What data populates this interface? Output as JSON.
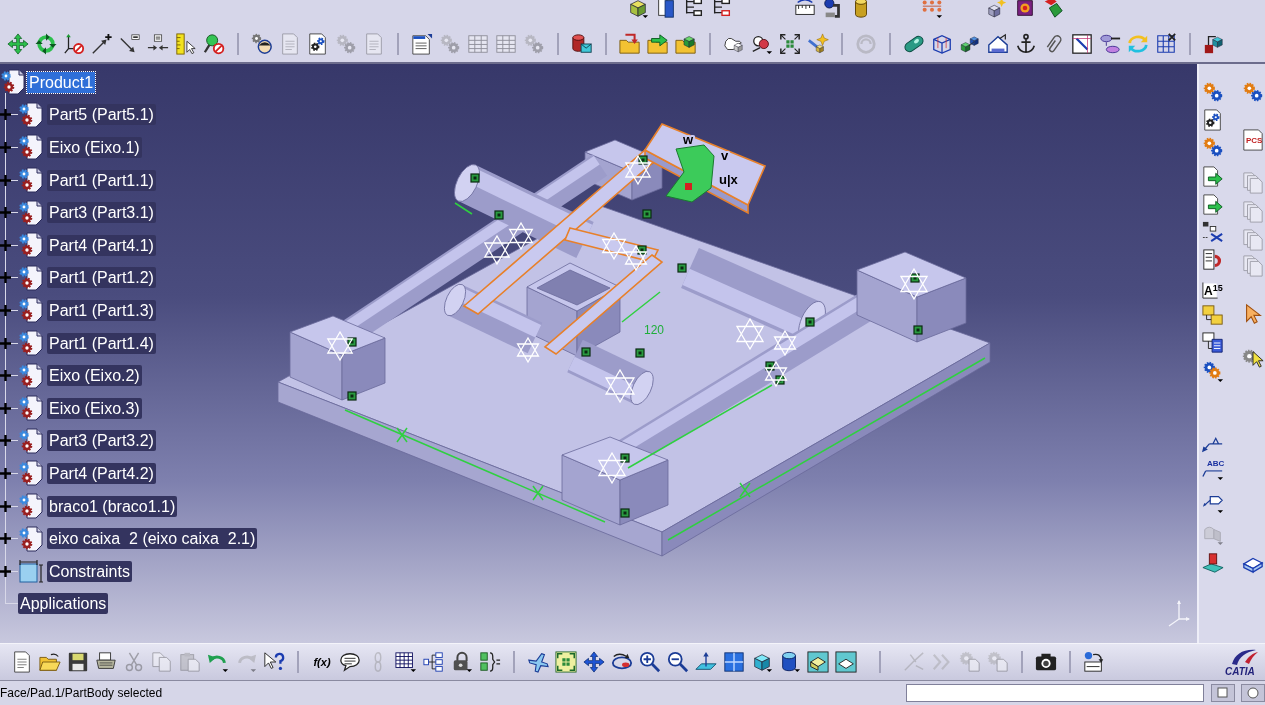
{
  "main_toolbar": {
    "buttons": [
      {
        "disabled": false
      },
      {
        "disabled": false
      },
      {
        "disabled": false
      },
      {
        "disabled": false
      },
      {
        "disabled": false
      },
      {
        "disabled": false
      },
      {
        "disabled": false
      },
      {
        "disabled": false
      },
      {
        "disabled": false
      },
      {
        "disabled": true
      },
      {
        "disabled": false
      },
      {
        "disabled": true
      },
      {
        "disabled": true
      },
      {
        "disabled": false
      },
      {
        "disabled": true
      },
      {
        "disabled": true
      },
      {
        "disabled": true
      },
      {
        "disabled": true
      },
      {
        "disabled": false
      },
      {
        "disabled": false
      },
      {
        "disabled": false
      },
      {
        "disabled": false
      },
      {
        "disabled": false
      },
      {
        "disabled": false
      },
      {
        "disabled": false
      },
      {
        "disabled": false
      },
      {
        "disabled": true
      },
      {
        "disabled": false
      },
      {
        "disabled": false
      },
      {
        "disabled": false
      },
      {
        "disabled": false
      },
      {
        "disabled": false
      },
      {
        "disabled": false
      },
      {
        "disabled": false
      },
      {
        "disabled": false
      },
      {
        "disabled": false
      },
      {
        "disabled": false
      },
      {
        "disabled": false
      }
    ]
  },
  "tree": {
    "root": {
      "label": "Product1",
      "selected": true
    },
    "children": [
      {
        "kind": "part",
        "label": "Part5 (Part5.1)",
        "expanded": false,
        "selected": false
      },
      {
        "kind": "part",
        "label": "Eixo (Eixo.1)",
        "expanded": false,
        "selected": false
      },
      {
        "kind": "part",
        "label": "Part1 (Part1.1)",
        "expanded": false,
        "selected": false
      },
      {
        "kind": "part",
        "label": "Part3 (Part3.1)",
        "expanded": false,
        "selected": false
      },
      {
        "kind": "part",
        "label": "Part4 (Part4.1)",
        "expanded": false,
        "selected": false
      },
      {
        "kind": "part",
        "label": "Part1 (Part1.2)",
        "expanded": false,
        "selected": false
      },
      {
        "kind": "part",
        "label": "Part1 (Part1.3)",
        "expanded": false,
        "selected": false
      },
      {
        "kind": "part",
        "label": "Part1 (Part1.4)",
        "expanded": false,
        "selected": false
      },
      {
        "kind": "part",
        "label": "Eixo (Eixo.2)",
        "expanded": false,
        "selected": false
      },
      {
        "kind": "part",
        "label": "Eixo (Eixo.3)",
        "expanded": false,
        "selected": false
      },
      {
        "kind": "part",
        "label": "Part3 (Part3.2)",
        "expanded": false,
        "selected": false
      },
      {
        "kind": "part",
        "label": "Part4 (Part4.2)",
        "expanded": false,
        "selected": false
      },
      {
        "kind": "part",
        "label": "braco1 (braco1.1)",
        "expanded": false,
        "selected": false
      },
      {
        "kind": "part",
        "label": "eixo caixa  2 (eixo caixa  2.1)",
        "expanded": false,
        "selected": false
      },
      {
        "kind": "constraints",
        "label": "Constraints",
        "expanded": false,
        "selected": false
      }
    ],
    "applications": {
      "label": "Applications",
      "selected": false
    }
  },
  "viewport": {
    "labels": [
      {
        "kind": "axis",
        "text": "w"
      },
      {
        "kind": "axis",
        "text": "v"
      },
      {
        "kind": "axis",
        "text": "u|x"
      },
      {
        "kind": "dimension",
        "text": "120"
      }
    ]
  },
  "right_toolbar": {
    "column_1": [
      {
        "disabled": false
      },
      {
        "disabled": false
      },
      {
        "disabled": false
      },
      {
        "disabled": false
      },
      {
        "disabled": false
      },
      {
        "disabled": false
      },
      {
        "disabled": false
      },
      {
        "disabled": false,
        "label": "A$^{15}$"
      },
      {
        "disabled": false
      },
      {
        "disabled": false
      },
      {
        "disabled": false
      },
      {
        "disabled": false
      },
      {
        "disabled": false,
        "label": "ABC"
      },
      {
        "disabled": false
      },
      {
        "disabled": true
      },
      {
        "disabled": false
      }
    ],
    "column_2": [
      {
        "disabled": false
      },
      {
        "disabled": false,
        "label": "PCS"
      },
      {
        "disabled": true
      },
      {
        "disabled": true
      },
      {
        "disabled": true
      },
      {
        "disabled": true
      },
      {
        "disabled": false
      },
      {
        "disabled": false
      },
      {
        "disabled": false
      }
    ]
  },
  "bottom_toolbar": {
    "buttons": [
      {
        "disabled": false
      },
      {
        "disabled": false
      },
      {
        "disabled": false
      },
      {
        "disabled": false
      },
      {
        "disabled": true
      },
      {
        "disabled": true
      },
      {
        "disabled": true
      },
      {
        "disabled": false
      },
      {
        "disabled": true
      },
      {
        "disabled": false
      },
      {
        "disabled": false,
        "label": "f(x)"
      },
      {
        "disabled": false
      },
      {
        "disabled": true
      },
      {
        "disabled": false
      },
      {
        "disabled": false
      },
      {
        "disabled": false
      },
      {
        "disabled": false
      },
      {
        "disabled": false
      },
      {
        "disabled": false
      },
      {
        "disabled": false
      },
      {
        "disabled": false
      },
      {
        "disabled": false
      },
      {
        "disabled": false
      },
      {
        "disabled": false
      },
      {
        "disabled": false
      },
      {
        "disabled": false
      },
      {
        "disabled": false
      },
      {
        "disabled": false
      },
      {
        "disabled": false
      },
      {
        "disabled": true
      },
      {
        "disabled": true
      },
      {
        "disabled": true
      },
      {
        "disabled": true
      },
      {
        "disabled": false
      },
      {
        "disabled": false
      }
    ]
  },
  "logo": {
    "text": "CATIA"
  },
  "status_bar": {
    "message": "Face/Pad.1/PartBody selected"
  }
}
